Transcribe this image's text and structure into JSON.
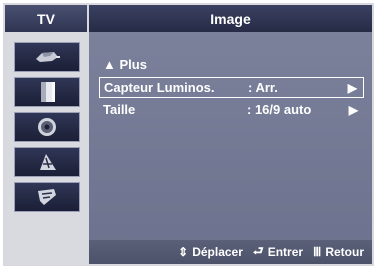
{
  "header": {
    "section": "TV",
    "title": "Image"
  },
  "sidebar": {
    "items": [
      {
        "icon": "tv-picture-icon"
      },
      {
        "icon": "sound-icon"
      },
      {
        "icon": "channel-icon"
      },
      {
        "icon": "setup-icon"
      },
      {
        "icon": "input-icon"
      }
    ]
  },
  "menu": {
    "up": {
      "glyph": "▲",
      "label": "Plus"
    },
    "rows": [
      {
        "label": "Capteur Luminos.",
        "value": ": Arr.",
        "arrow": "▶",
        "selected": true
      },
      {
        "label": "Taille",
        "value": ": 16/9 auto",
        "arrow": "▶",
        "selected": false
      }
    ]
  },
  "footer": {
    "move_glyph": "⇕",
    "move": "Déplacer",
    "enter_glyph": "⮐",
    "enter": "Entrer",
    "return_glyph": "Ⅲ",
    "return": "Retour"
  },
  "colors": {
    "panel": "#6f7691",
    "header": "#2f3552",
    "sidebar": "#d9dae0",
    "text": "#ffffff"
  }
}
